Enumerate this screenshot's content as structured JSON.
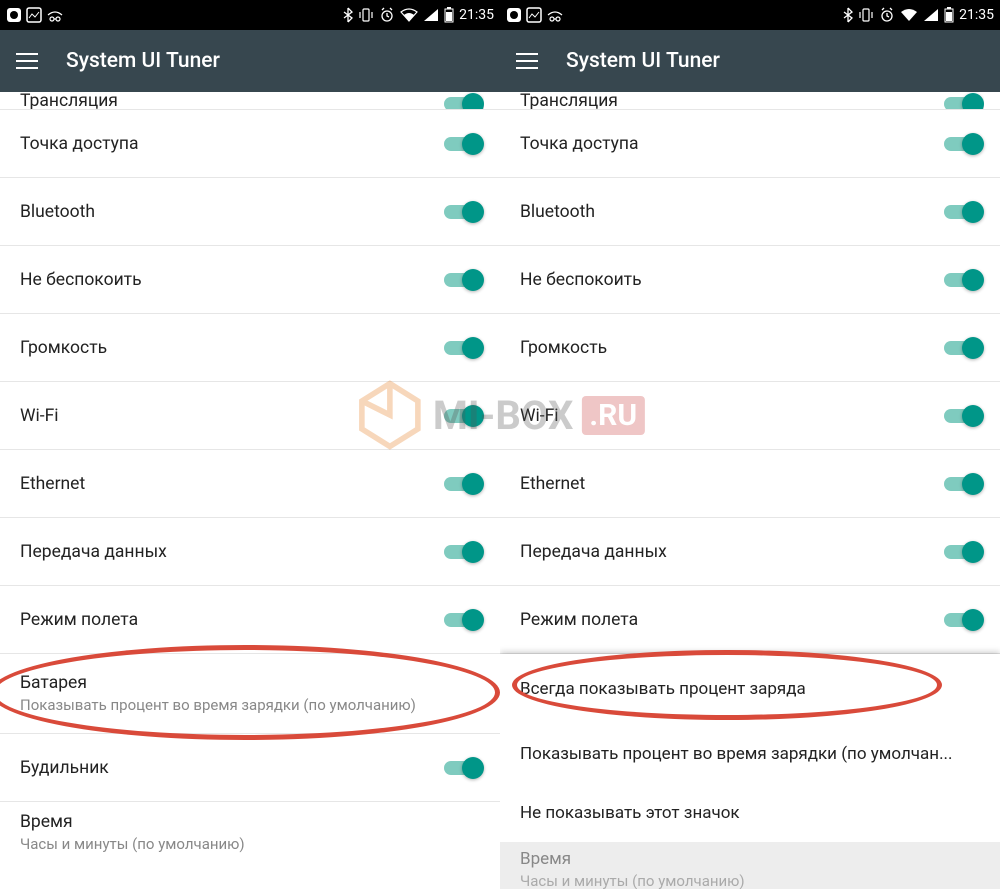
{
  "status": {
    "time": "21:35",
    "icons_left": [
      "app-icon-1",
      "app-icon-2",
      "incognito-icon"
    ],
    "icons_right": [
      "bluetooth-icon",
      "vibrate-icon",
      "alarm-icon",
      "wifi-icon",
      "signal-icon",
      "battery-icon"
    ]
  },
  "appbar": {
    "title": "System UI Tuner"
  },
  "left": {
    "partial_top": "Трансляция",
    "items": [
      {
        "label": "Точка доступа",
        "toggle": true
      },
      {
        "label": "Bluetooth",
        "toggle": true
      },
      {
        "label": "Не беспокоить",
        "toggle": true
      },
      {
        "label": "Громкость",
        "toggle": true
      },
      {
        "label": "Wi-Fi",
        "toggle": true
      },
      {
        "label": "Ethernet",
        "toggle": true
      },
      {
        "label": "Передача данных",
        "toggle": true
      },
      {
        "label": "Режим полета",
        "toggle": true
      }
    ],
    "battery": {
      "label": "Батарея",
      "sub": "Показывать процент во время зарядки (по умолчанию)"
    },
    "alarm": {
      "label": "Будильник",
      "toggle": true
    },
    "time_row": {
      "label": "Время",
      "sub": "Часы и минуты (по умолчанию)"
    }
  },
  "right": {
    "partial_top": "Трансляция",
    "items": [
      {
        "label": "Точка доступа",
        "toggle": true
      },
      {
        "label": "Bluetooth",
        "toggle": true
      },
      {
        "label": "Не беспокоить",
        "toggle": true
      },
      {
        "label": "Громкость",
        "toggle": true
      },
      {
        "label": "Wi-Fi",
        "toggle": true
      },
      {
        "label": "Ethernet",
        "toggle": true
      },
      {
        "label": "Передача данных",
        "toggle": true
      },
      {
        "label": "Режим полета",
        "toggle": true
      }
    ],
    "popup": {
      "option1": "Всегда показывать процент заряда",
      "option2": "Показывать процент во время зарядки (по умолчан...",
      "option3": "Не показывать этот значок"
    },
    "dimmed": {
      "label": "Время",
      "sub": "Часы и минуты (по умолчанию)"
    }
  },
  "watermark": {
    "text": "MI-BOX",
    "suffix": ".RU"
  }
}
